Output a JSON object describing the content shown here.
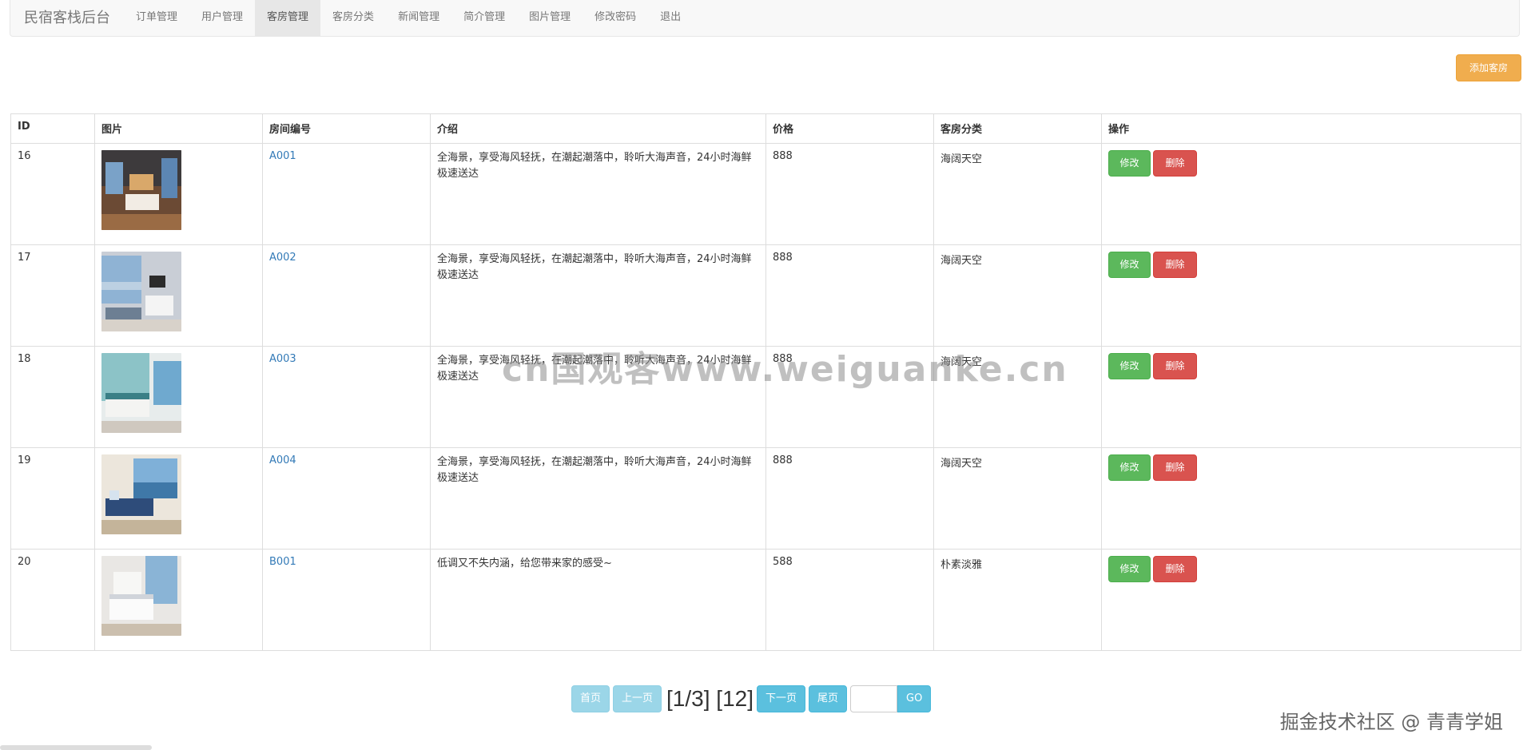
{
  "nav": {
    "brand": "民宿客栈后台",
    "items": [
      {
        "label": "订单管理"
      },
      {
        "label": "用户管理"
      },
      {
        "label": "客房管理",
        "active": true
      },
      {
        "label": "客房分类"
      },
      {
        "label": "新闻管理"
      },
      {
        "label": "简介管理"
      },
      {
        "label": "图片管理"
      },
      {
        "label": "修改密码"
      },
      {
        "label": "退出"
      }
    ]
  },
  "toolbar": {
    "add_label": "添加客房"
  },
  "table": {
    "headers": [
      "ID",
      "图片",
      "房间编号",
      "介绍",
      "价格",
      "客房分类",
      "操作"
    ],
    "rows": [
      {
        "id": "16",
        "room": "A001",
        "desc": "全海景，享受海风轻抚，在潮起潮落中，聆听大海声音，24小时海鲜极速送达",
        "price": "888",
        "category": "海阔天空"
      },
      {
        "id": "17",
        "room": "A002",
        "desc": "全海景，享受海风轻抚，在潮起潮落中，聆听大海声音，24小时海鲜极速送达",
        "price": "888",
        "category": "海阔天空"
      },
      {
        "id": "18",
        "room": "A003",
        "desc": "全海景，享受海风轻抚，在潮起潮落中，聆听大海声音，24小时海鲜极速送达",
        "price": "888",
        "category": "海阔天空"
      },
      {
        "id": "19",
        "room": "A004",
        "desc": "全海景，享受海风轻抚，在潮起潮落中，聆听大海声音，24小时海鲜极速送达",
        "price": "888",
        "category": "海阔天空"
      },
      {
        "id": "20",
        "room": "B001",
        "desc": "低调又不失内涵，给您带来家的感受~",
        "price": "588",
        "category": "朴素淡雅"
      }
    ],
    "edit_label": "修改",
    "delete_label": "删除"
  },
  "pager": {
    "first": "首页",
    "prev": "上一页",
    "info": "[1/3] [12]",
    "next": "下一页",
    "last": "尾页",
    "go": "GO"
  },
  "overlay": {
    "watermark": "cn国观客www.weiguanke.cn",
    "footer_brand": "掘金技术社区 @ 青青学姐"
  },
  "colors": {
    "add": "#f0ad4e",
    "edit": "#5cb85c",
    "delete": "#d9534f",
    "pager": "#5bc0de",
    "link": "#337ab7"
  }
}
